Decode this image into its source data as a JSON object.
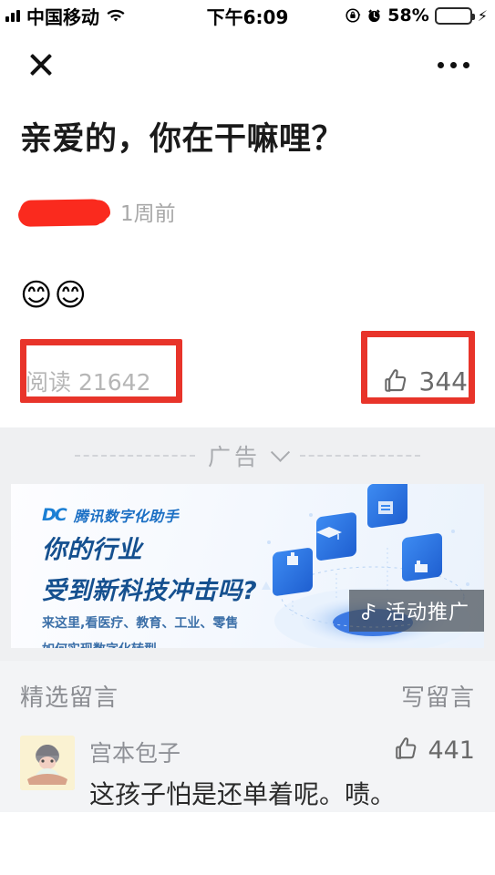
{
  "status_bar": {
    "signal_icon": "signal-bars-icon",
    "carrier": "中国移动",
    "wifi_icon": "wifi-icon",
    "time": "下午6:09",
    "rotation_lock_icon": "rotation-lock-icon",
    "alarm_icon": "alarm-clock-icon",
    "battery_percent": "58%",
    "battery_level": 58,
    "battery_color": "#ffd60a",
    "charging_icon": "lightning-bolt-icon"
  },
  "nav": {
    "close_icon": "close-icon",
    "more_icon": "more-options-icon"
  },
  "article": {
    "title": "亲爱的，你在干嘛哩？",
    "author_redacted": true,
    "redaction_color": "#fa2a1e",
    "time_ago": "1周前",
    "body_emoji": "😊😊",
    "read_label": "阅读",
    "read_count": "21642",
    "read_text": "阅读 21642",
    "like_icon": "thumbs-up-icon",
    "like_count": "344"
  },
  "annotations": {
    "color": "#e8342a",
    "boxes": [
      "read-count-highlight",
      "like-count-highlight"
    ]
  },
  "ad": {
    "label": "广告",
    "expand_icon": "chevron-down-icon",
    "logo_mark": "DC",
    "brand": "腾讯数字化助手",
    "headline_line1": "你的行业",
    "headline_line2": "受到新科技冲击吗?",
    "sub_line1": "来这里,看医疗、教育、工业、零售",
    "sub_line2": "如何实现数字化转型。",
    "promo_badge": "活动推广",
    "promo_icon": "music-note-icon",
    "accent_color": "#15508f"
  },
  "comments": {
    "section_title": "精选留言",
    "write_label": "写留言",
    "items": [
      {
        "avatar": "user-avatar",
        "name": "宫本包子",
        "like_icon": "thumbs-up-icon",
        "likes": "441",
        "text": "这孩子怕是还单着呢。啧。"
      }
    ]
  }
}
